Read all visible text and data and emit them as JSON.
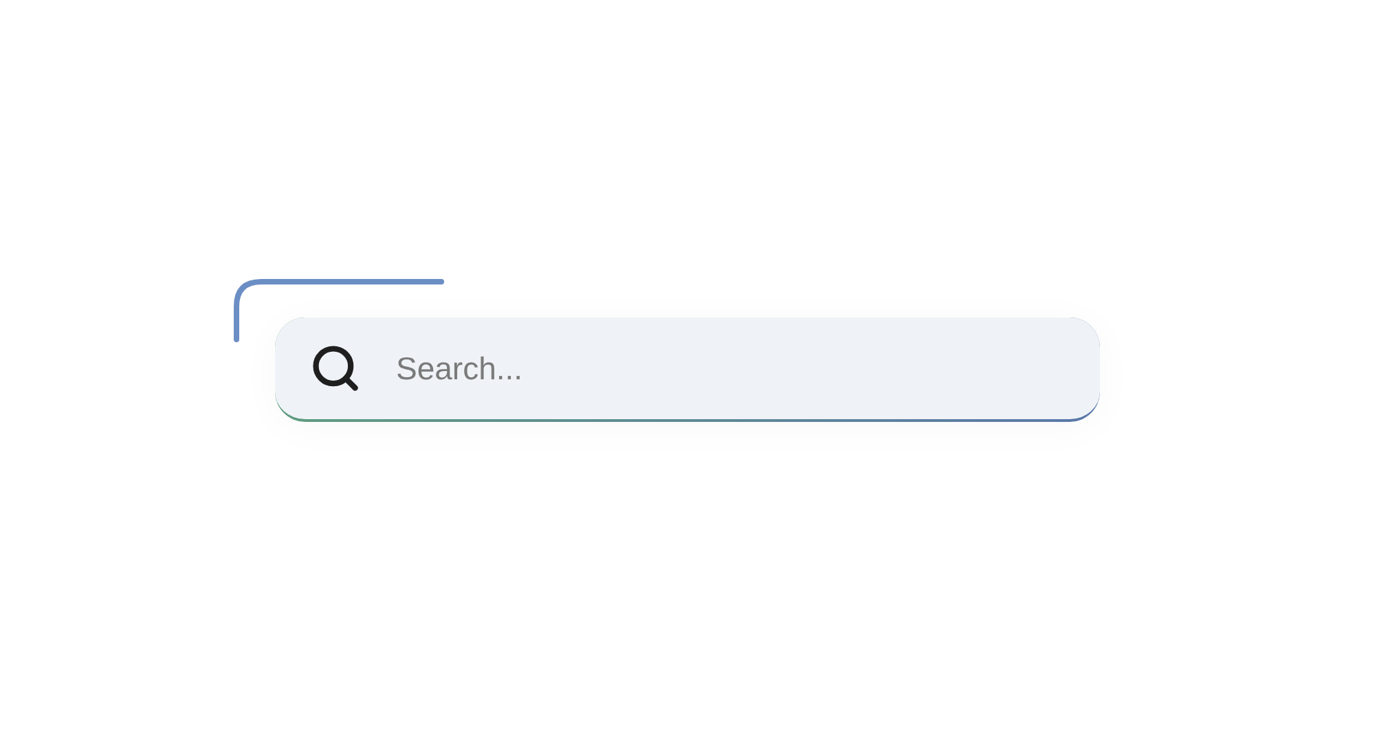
{
  "search": {
    "placeholder": "Search..."
  }
}
